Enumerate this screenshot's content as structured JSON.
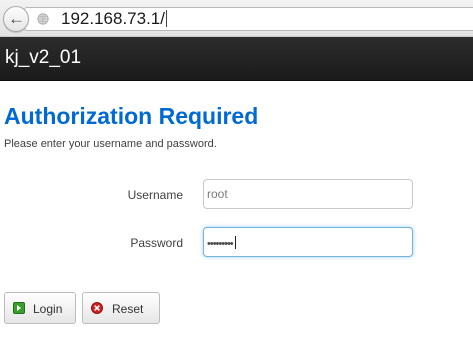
{
  "browser": {
    "url": "192.168.73.1/"
  },
  "header": {
    "brand": "kj_v2_01"
  },
  "auth": {
    "title": "Authorization Required",
    "subtitle": "Please enter your username and password.",
    "username_label": "Username",
    "username_value": "root",
    "password_label": "Password",
    "password_mask": "•••••••••"
  },
  "buttons": {
    "login_label": "Login",
    "reset_label": "Reset"
  },
  "colors": {
    "title": "#0069d6",
    "header_bg": "#1b1b1b",
    "login_icon": "#3a9e2f",
    "reset_icon": "#cc2222"
  }
}
